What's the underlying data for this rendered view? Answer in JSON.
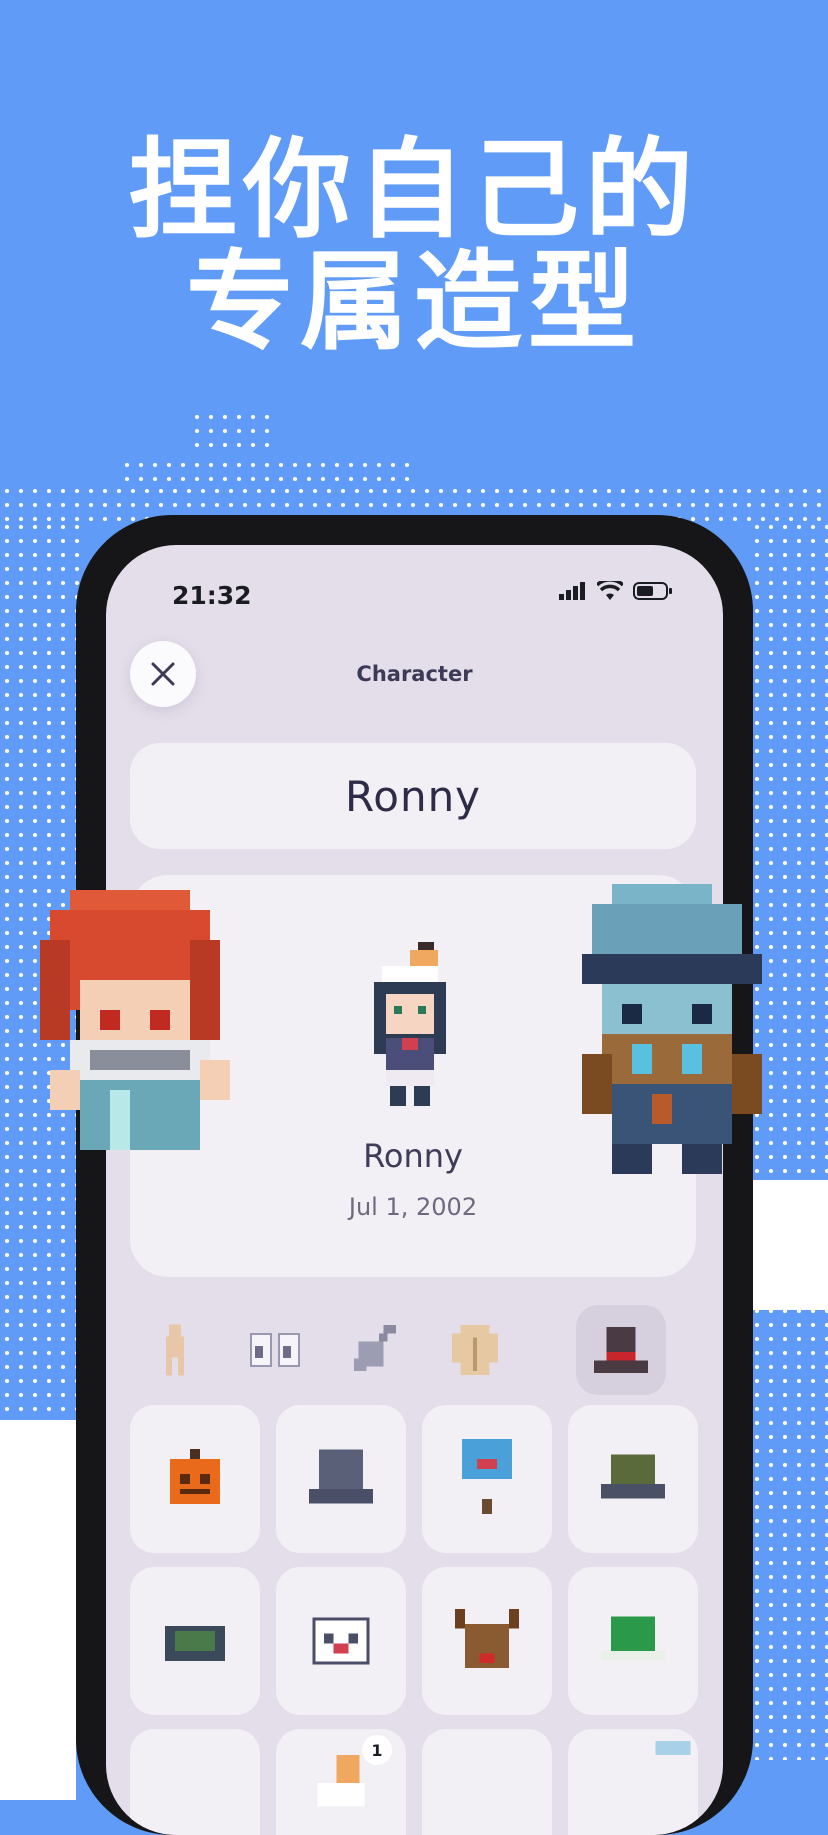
{
  "headline": {
    "line1": "捏你自己的",
    "line2": "专属造型"
  },
  "status_bar": {
    "time": "21:32"
  },
  "editor": {
    "nav_title": "Character",
    "name_value": "Ronny",
    "preview_name": "Ronny",
    "preview_date": "Jul 1, 2002"
  },
  "categories": [
    {
      "name": "body",
      "icon": "body-icon",
      "active": false
    },
    {
      "name": "eyes",
      "icon": "eyes-icon",
      "active": false
    },
    {
      "name": "hair",
      "icon": "brush-icon",
      "active": false
    },
    {
      "name": "outfit",
      "icon": "coat-icon",
      "active": false
    },
    {
      "name": "hat",
      "icon": "top-hat-icon",
      "active": true
    }
  ],
  "items": [
    {
      "icon": "pumpkin-hat-icon"
    },
    {
      "icon": "gray-top-hat-icon"
    },
    {
      "icon": "blue-bird-hat-icon"
    },
    {
      "icon": "turtle-shell-hat-icon"
    },
    {
      "icon": "green-bowl-hat-icon"
    },
    {
      "icon": "white-ghost-hat-icon"
    },
    {
      "icon": "reindeer-hat-icon"
    },
    {
      "icon": "green-cap-icon"
    },
    {
      "icon": "empty-slot"
    },
    {
      "icon": "ice-cream-hat-icon",
      "badge": "1"
    },
    {
      "icon": "empty-slot"
    },
    {
      "icon": "blue-item-icon"
    }
  ],
  "colors": {
    "background": "#5f9bf7",
    "screen": "#e4deea",
    "card": "#f2eff5",
    "text": "#2e2b47"
  }
}
